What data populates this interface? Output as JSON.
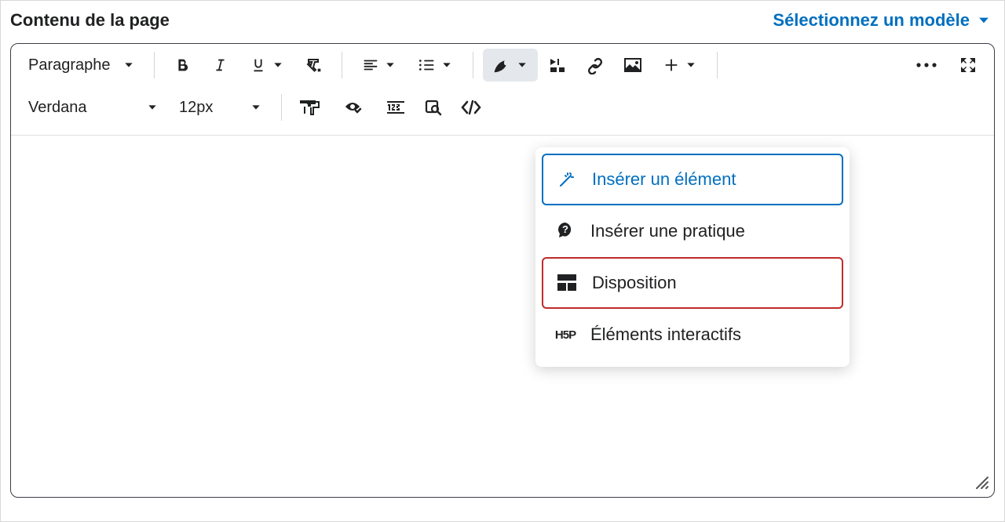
{
  "header": {
    "title": "Contenu de la page",
    "template_link": "Sélectionnez un modèle"
  },
  "toolbar": {
    "paragraph": "Paragraphe",
    "font": "Verdana",
    "size": "12px"
  },
  "dropdown": {
    "insert_element": "Insérer un élément",
    "insert_practice": "Insérer une pratique",
    "layout": "Disposition",
    "interactive": "Éléments interactifs"
  }
}
